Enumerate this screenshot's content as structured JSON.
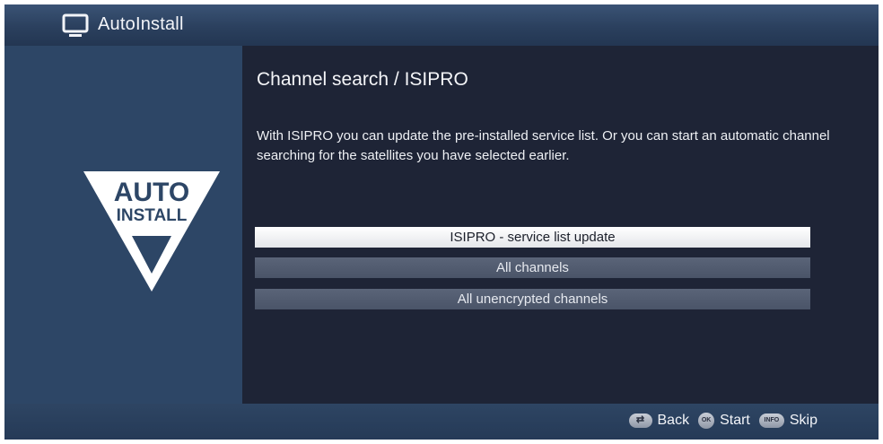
{
  "header": {
    "title": "AutoInstall",
    "icon": "tv-icon"
  },
  "sidebar": {
    "logo": {
      "icon": "auto-install-triangle-icon",
      "line1": "AUTO",
      "line2": "INSTALL"
    }
  },
  "main": {
    "title": "Channel search / ISIPRO",
    "description": "With ISIPRO you can update the pre-installed service list. Or you can start an automatic channel searching for the satellites you have selected earlier.",
    "options": [
      {
        "label": "ISIPRO - service list update",
        "selected": true
      },
      {
        "label": "All channels",
        "selected": false
      },
      {
        "label": "All unencrypted channels",
        "selected": false
      }
    ]
  },
  "footer": {
    "back": {
      "key": "⇄",
      "label": "Back"
    },
    "start": {
      "key": "OK",
      "label": "Start"
    },
    "skip": {
      "key": "INFO",
      "label": "Skip"
    }
  },
  "colors": {
    "background": "#1e2436",
    "header": "#2b405e",
    "sidebar": "#2d4666",
    "option": "#525c70",
    "option_selected": "#f2f3f5"
  }
}
